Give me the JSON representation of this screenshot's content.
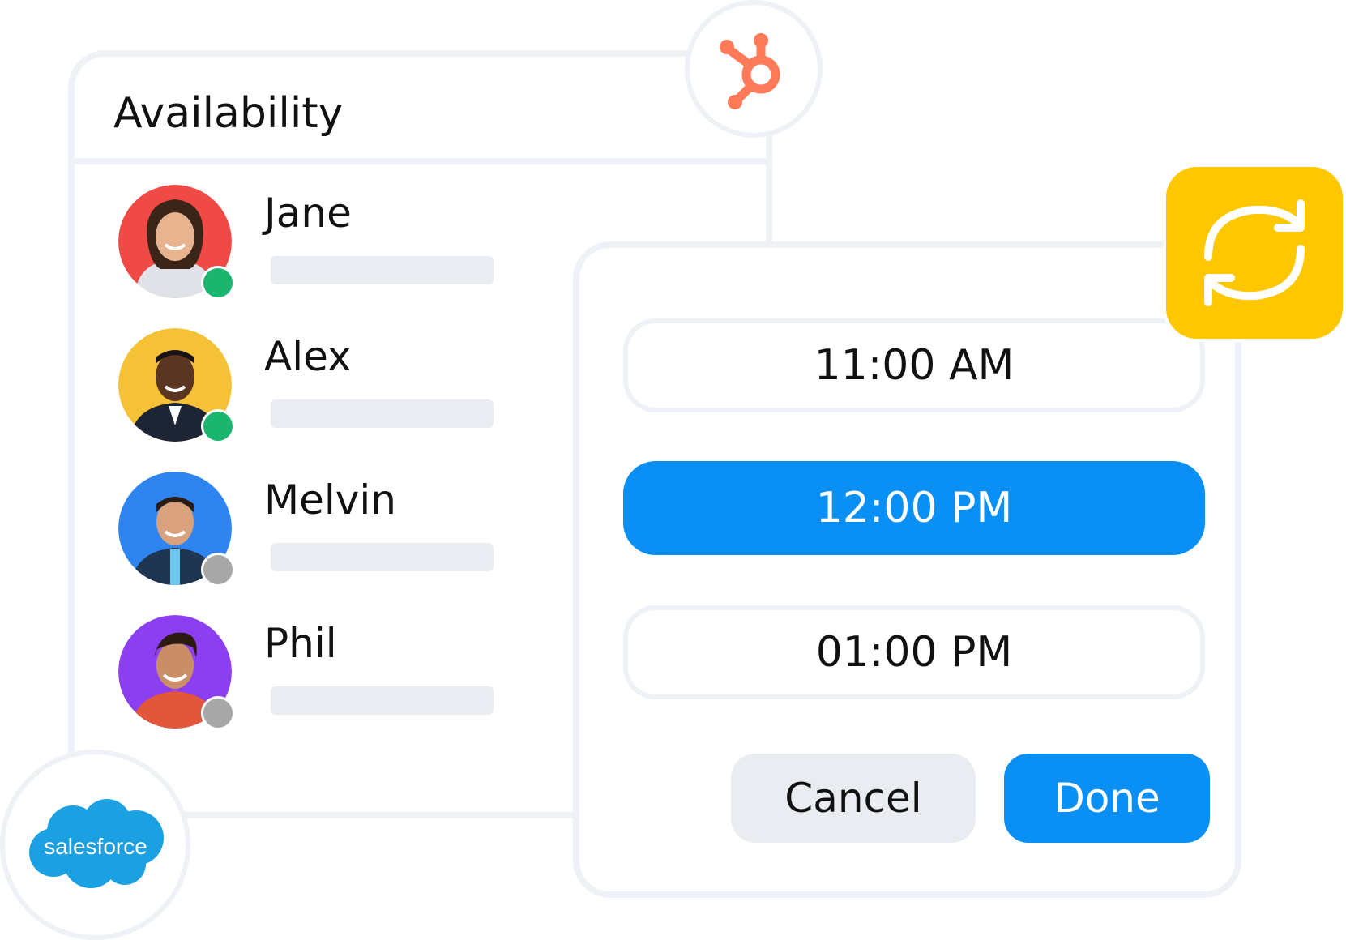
{
  "availability": {
    "title": "Availability",
    "people": [
      {
        "name": "Jane",
        "status": "online",
        "avatar_bg": "#f04a46"
      },
      {
        "name": "Alex",
        "status": "online",
        "avatar_bg": "#f5c136"
      },
      {
        "name": "Melvin",
        "status": "offline",
        "avatar_bg": "#2f85f0"
      },
      {
        "name": "Phil",
        "status": "offline",
        "avatar_bg": "#8b3ff0"
      }
    ]
  },
  "time_picker": {
    "slots": [
      {
        "label": "11:00 AM",
        "selected": false
      },
      {
        "label": "12:00 PM",
        "selected": true
      },
      {
        "label": "01:00 PM",
        "selected": false
      }
    ],
    "cancel_label": "Cancel",
    "done_label": "Done"
  },
  "integrations": {
    "salesforce_label": "salesforce",
    "hubspot_icon": "hubspot-icon",
    "sync_icon": "sync-icon"
  },
  "colors": {
    "accent": "#0a8ff5",
    "online": "#1bb56f",
    "offline": "#a7a7a7",
    "hubspot": "#ff7a59",
    "salesforce": "#1ba1e2",
    "sync": "#ffc700",
    "border": "#eef1f6"
  }
}
